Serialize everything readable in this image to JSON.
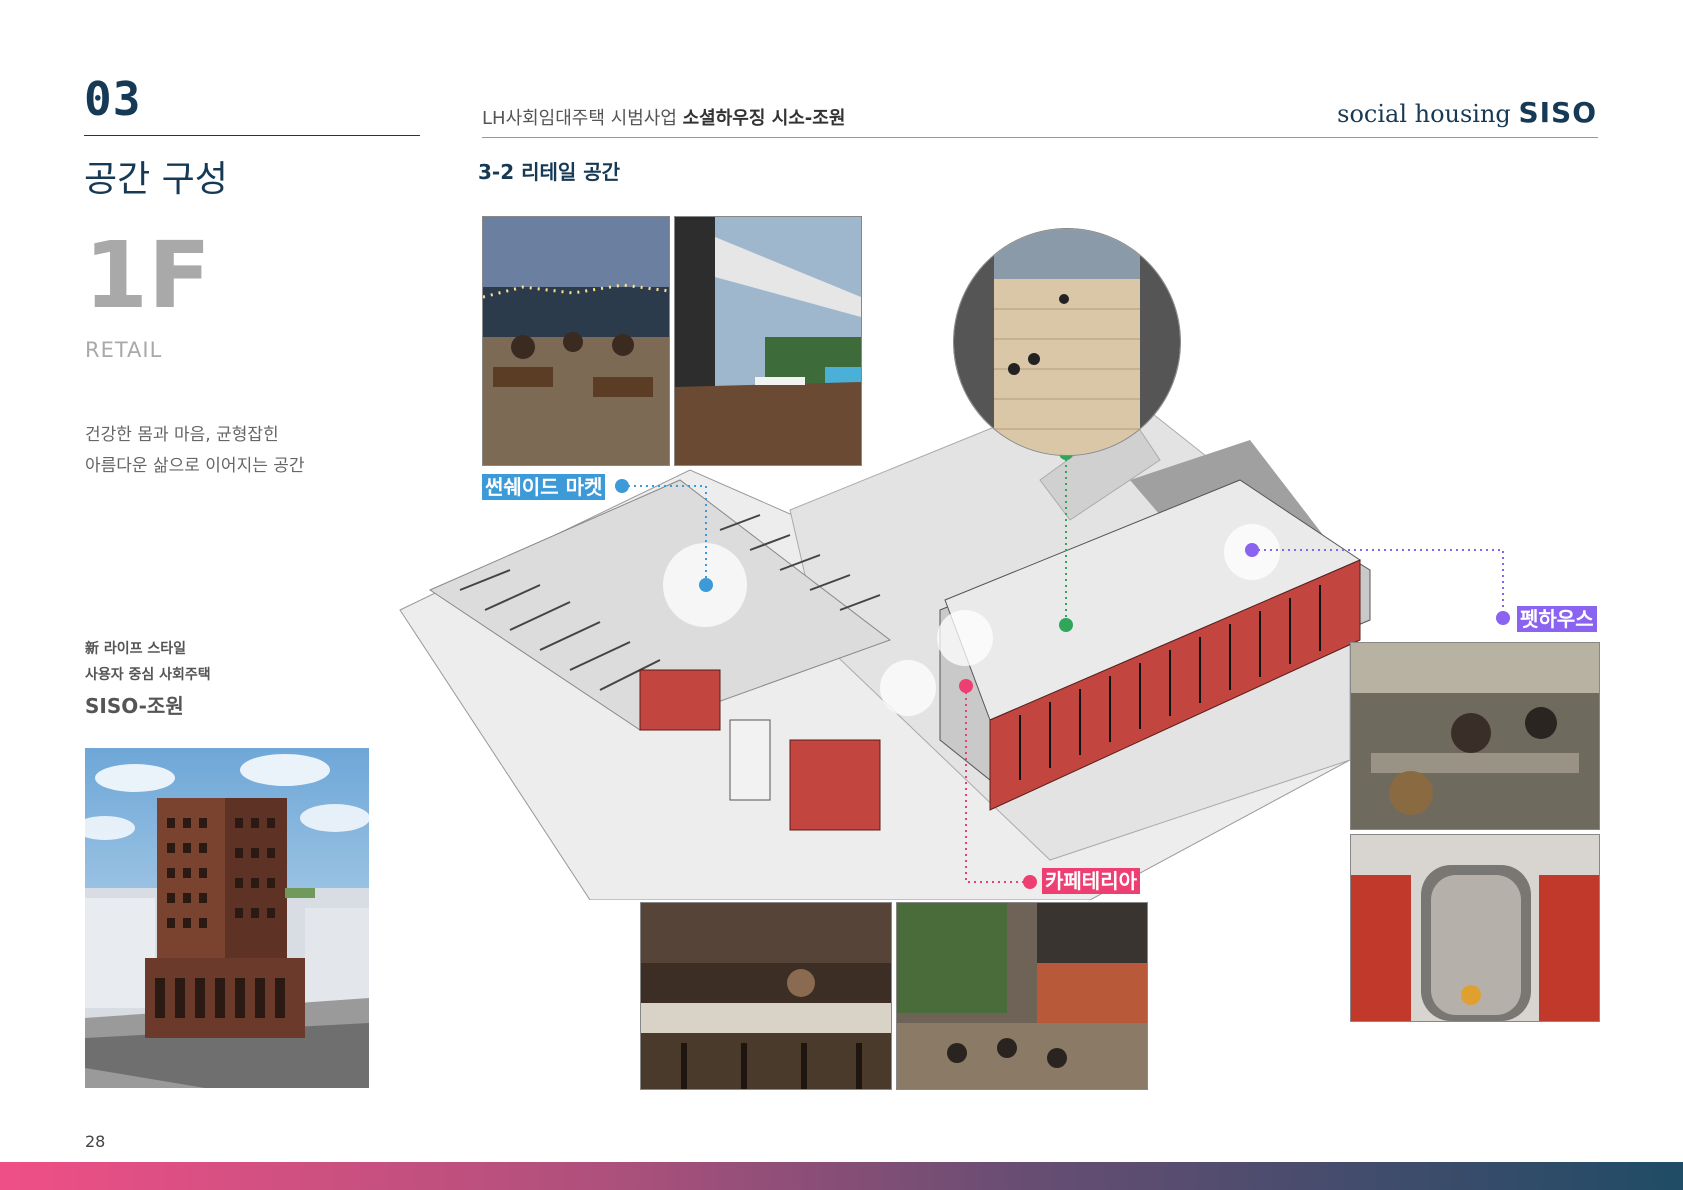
{
  "section": {
    "number": "03",
    "title": "공간 구성"
  },
  "floor": {
    "label": "1F",
    "sub": "RETAIL"
  },
  "description": {
    "line1": "건강한 몸과 마음, 균형잡힌",
    "line2": "아름다운 삶으로 이어지는 공간"
  },
  "lifestyle": {
    "line1": "新 라이프 스타일",
    "line2": "사용자 중심  사회주택",
    "brand": "SISO-조원"
  },
  "header": {
    "prefix": "LH사회임대주택 시범사업",
    "title": "소셜하우징 시소-조원",
    "brand_script": "social housing",
    "brand_bold": "SISO"
  },
  "subsection": "3-2  리테일 공간",
  "tags": {
    "market": "썬쉐이드 마켓",
    "pet": "펫하우스",
    "cafe": "카페테리아"
  },
  "colors": {
    "market": "#3d9ad8",
    "pet": "#8a63f0",
    "cafe": "#ee3f72",
    "accent_dark": "#163a55"
  },
  "page_number": "28"
}
